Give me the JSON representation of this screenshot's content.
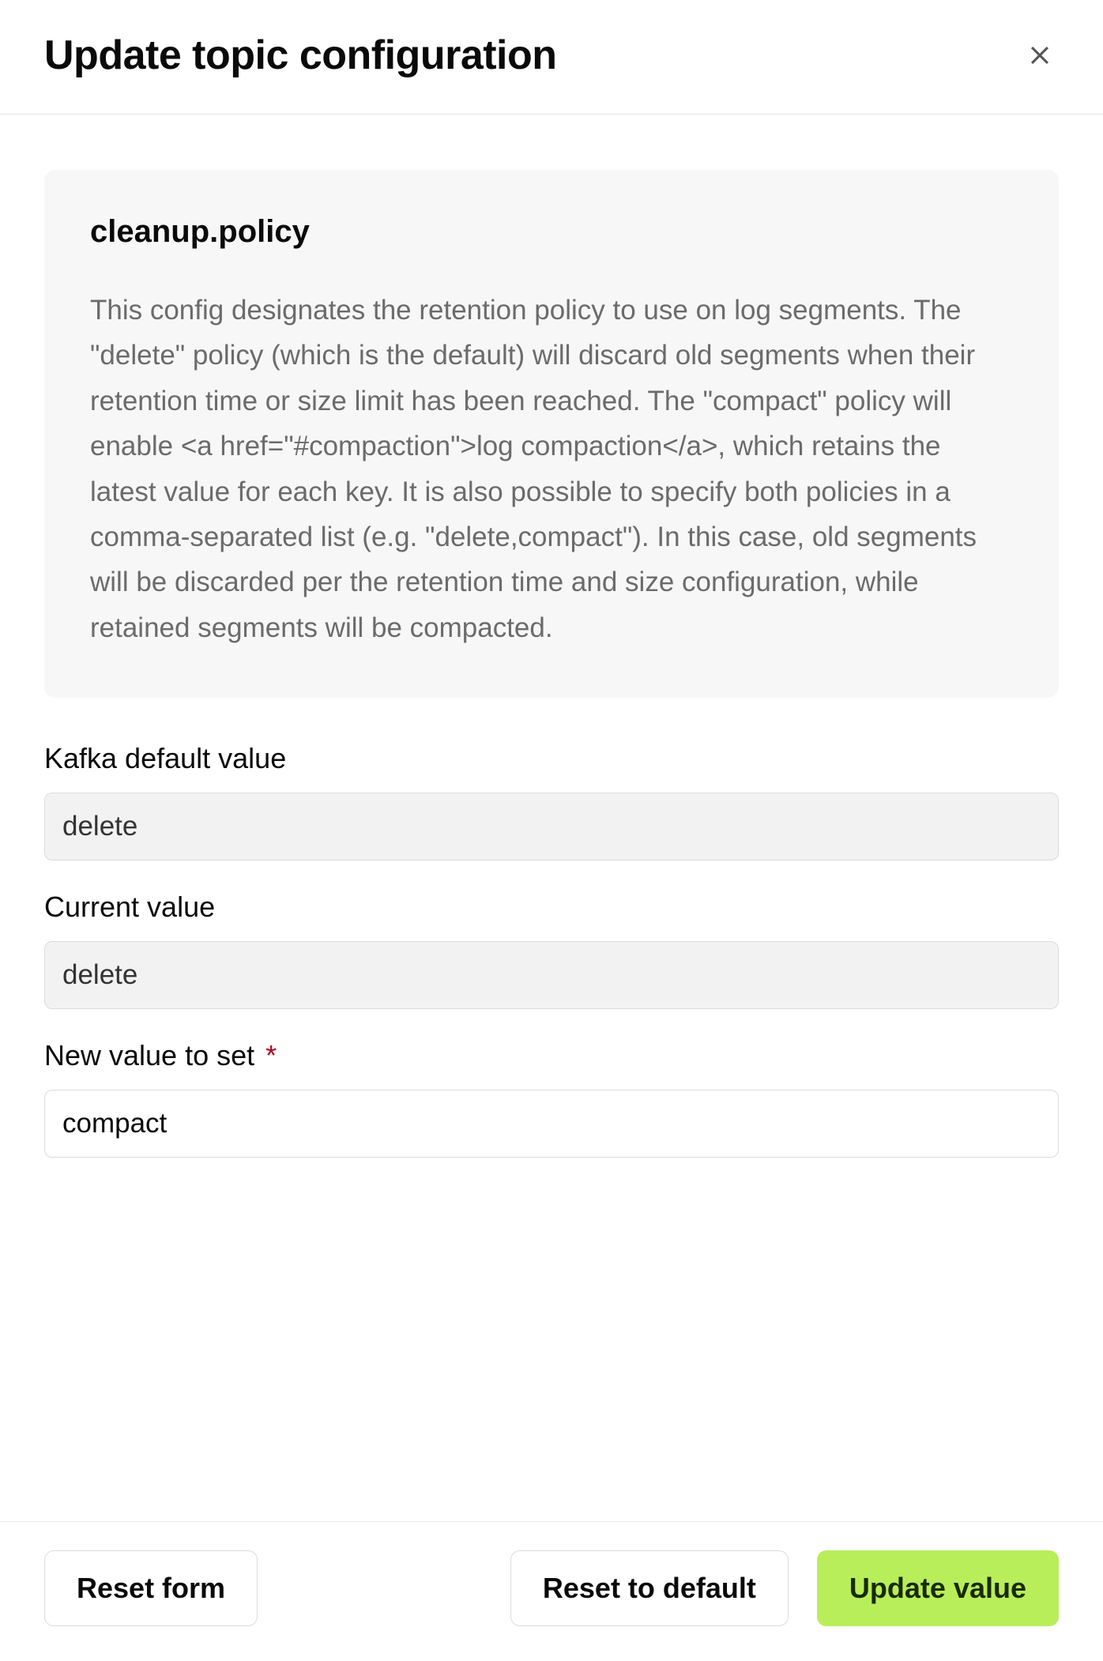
{
  "header": {
    "title": "Update topic configuration"
  },
  "info": {
    "title": "cleanup.policy",
    "description": "This config designates the retention policy to use on log segments. The \"delete\" policy (which is the default) will discard old segments when their retention time or size limit has been reached. The \"compact\" policy will enable <a href=\"#compaction\">log compaction</a>, which retains the latest value for each key. It is also possible to specify both policies in a comma-separated list (e.g. \"delete,compact\"). In this case, old segments will be discarded per the retention time and size configuration, while retained segments will be compacted."
  },
  "form": {
    "default_label": "Kafka default value",
    "default_value": "delete",
    "current_label": "Current value",
    "current_value": "delete",
    "new_label": "New value to set",
    "new_required_marker": "*",
    "new_value": "compact"
  },
  "footer": {
    "reset_form": "Reset form",
    "reset_default": "Reset to default",
    "update": "Update value"
  }
}
